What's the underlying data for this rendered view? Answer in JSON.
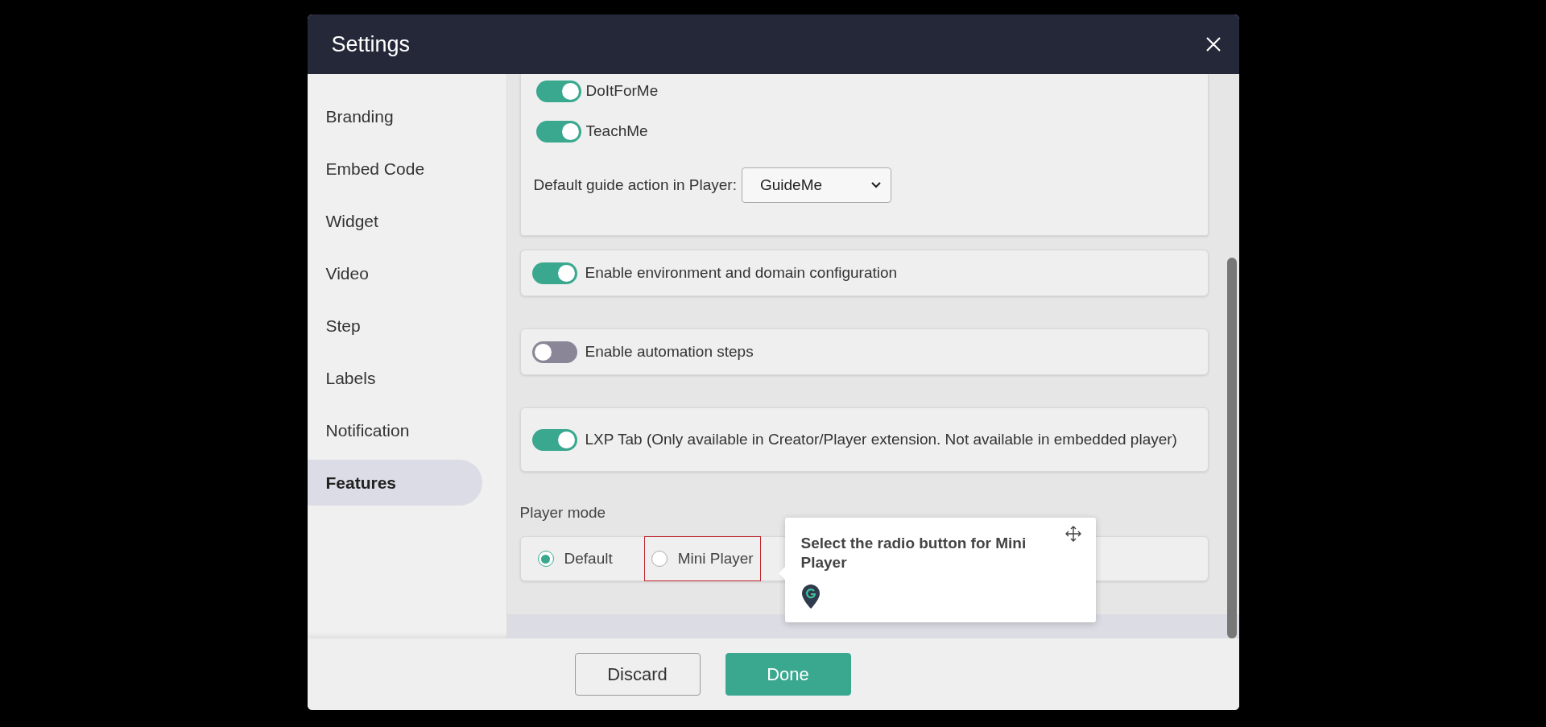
{
  "dialog": {
    "title": "Settings"
  },
  "sidebar": {
    "items": [
      {
        "label": "Branding",
        "selected": false
      },
      {
        "label": "Embed Code",
        "selected": false
      },
      {
        "label": "Widget",
        "selected": false
      },
      {
        "label": "Video",
        "selected": false
      },
      {
        "label": "Step",
        "selected": false
      },
      {
        "label": "Labels",
        "selected": false
      },
      {
        "label": "Notification",
        "selected": false
      },
      {
        "label": "Features",
        "selected": true
      }
    ]
  },
  "features": {
    "guide_toggles": [
      {
        "label": "DoItForMe",
        "on": true
      },
      {
        "label": "TeachMe",
        "on": true
      }
    ],
    "default_action": {
      "label": "Default guide action in Player:",
      "value": "GuideMe"
    },
    "options": [
      {
        "label": "Enable environment and domain configuration",
        "on": true
      },
      {
        "label": "Enable automation steps",
        "on": false
      },
      {
        "label": "LXP Tab (Only available in Creator/Player extension. Not available in embedded player)",
        "on": true
      }
    ],
    "player_mode": {
      "label": "Player mode",
      "options": [
        {
          "label": "Default",
          "selected": true,
          "highlighted": false
        },
        {
          "label": "Mini Player",
          "selected": false,
          "highlighted": true
        }
      ]
    }
  },
  "tooltip": {
    "text": "Select the radio button for Mini Player"
  },
  "buttons": [
    {
      "label": "Discard",
      "kind": "secondary"
    },
    {
      "label": "Done",
      "kind": "primary"
    }
  ]
}
